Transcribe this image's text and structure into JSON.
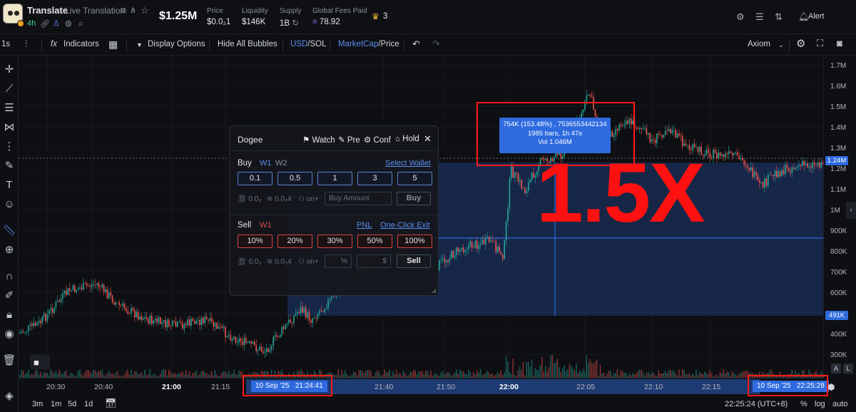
{
  "header": {
    "token_name": "Translate",
    "token_subtitle": "Live Translation",
    "age": "4h",
    "market_cap": "$1.25M",
    "stats": [
      {
        "label": "Price",
        "value": "$0.0₂1"
      },
      {
        "label": "Liquidity",
        "value": "$146K"
      },
      {
        "label": "Supply",
        "value": "1B"
      },
      {
        "label": "Global Fees Paid",
        "value": "78.92"
      }
    ],
    "holders_count": "3",
    "alert_label": "Alert"
  },
  "toolbar": {
    "interval": "1s",
    "indicators": "Indicators",
    "display_options": "Display Options",
    "hide_bubbles": "Hide All Bubbles",
    "currency_active": "USD",
    "currency_other": "/SOL",
    "mode_active": "MarketCap",
    "mode_other": "/Price",
    "provider": "Axiom"
  },
  "price_axis": {
    "ticks": [
      "1.7M",
      "1.6M",
      "1.5M",
      "1.4M",
      "1.3M",
      "1.2M",
      "1.1M",
      "1M",
      "900K",
      "800K",
      "700K",
      "600K",
      "400K",
      "300K"
    ],
    "current_tag": "1.24M",
    "low_tag": "491K",
    "tag_color": "#2f6bdf"
  },
  "time_axis": {
    "ticks": [
      "20:30",
      "20:40",
      "21:00",
      "21:15",
      "21:40",
      "21:50",
      "22:00",
      "22:05",
      "22:10",
      "22:15"
    ],
    "start_tag": "10 Sep '25   21:24:41",
    "end_tag": "10 Sep '25   22:25:28"
  },
  "bottom_bar": {
    "ranges": [
      "3m",
      "1m",
      "5d",
      "1d"
    ],
    "clock": "22:25:24 (UTC+8)",
    "percent": "%",
    "log": "log",
    "auto": "auto"
  },
  "tooltip": {
    "line1": "754K (153.48%) , 7536553442134",
    "line2": "1985 bars, 1h 47s",
    "line3": "Vol 1.046M"
  },
  "overlay_text": "1.5X",
  "overlay_color": "#ff1111",
  "panel": {
    "title": "Dogee",
    "actions": [
      "Watch",
      "Pre",
      "Conf",
      "Hold"
    ],
    "buy_label": "Buy",
    "buy_wallets": [
      "W1",
      "W2"
    ],
    "select_wallet": "Select Wallet",
    "buy_amounts": [
      "0.1",
      "0.5",
      "1",
      "3",
      "5"
    ],
    "fee1": "0.0₃",
    "fee2": "0.0₂4",
    "fee3": "on+",
    "buy_placeholder": "Buy Amount",
    "buy_button": "Buy",
    "sell_label": "Sell",
    "sell_wallet": "W1",
    "pnl": "PNL",
    "one_click_exit": "One-Click Exit",
    "sell_percents": [
      "10%",
      "20%",
      "30%",
      "50%",
      "100%"
    ],
    "sell_pct_placeholder": "%",
    "sell_usd_placeholder": "$",
    "sell_button": "Sell"
  }
}
